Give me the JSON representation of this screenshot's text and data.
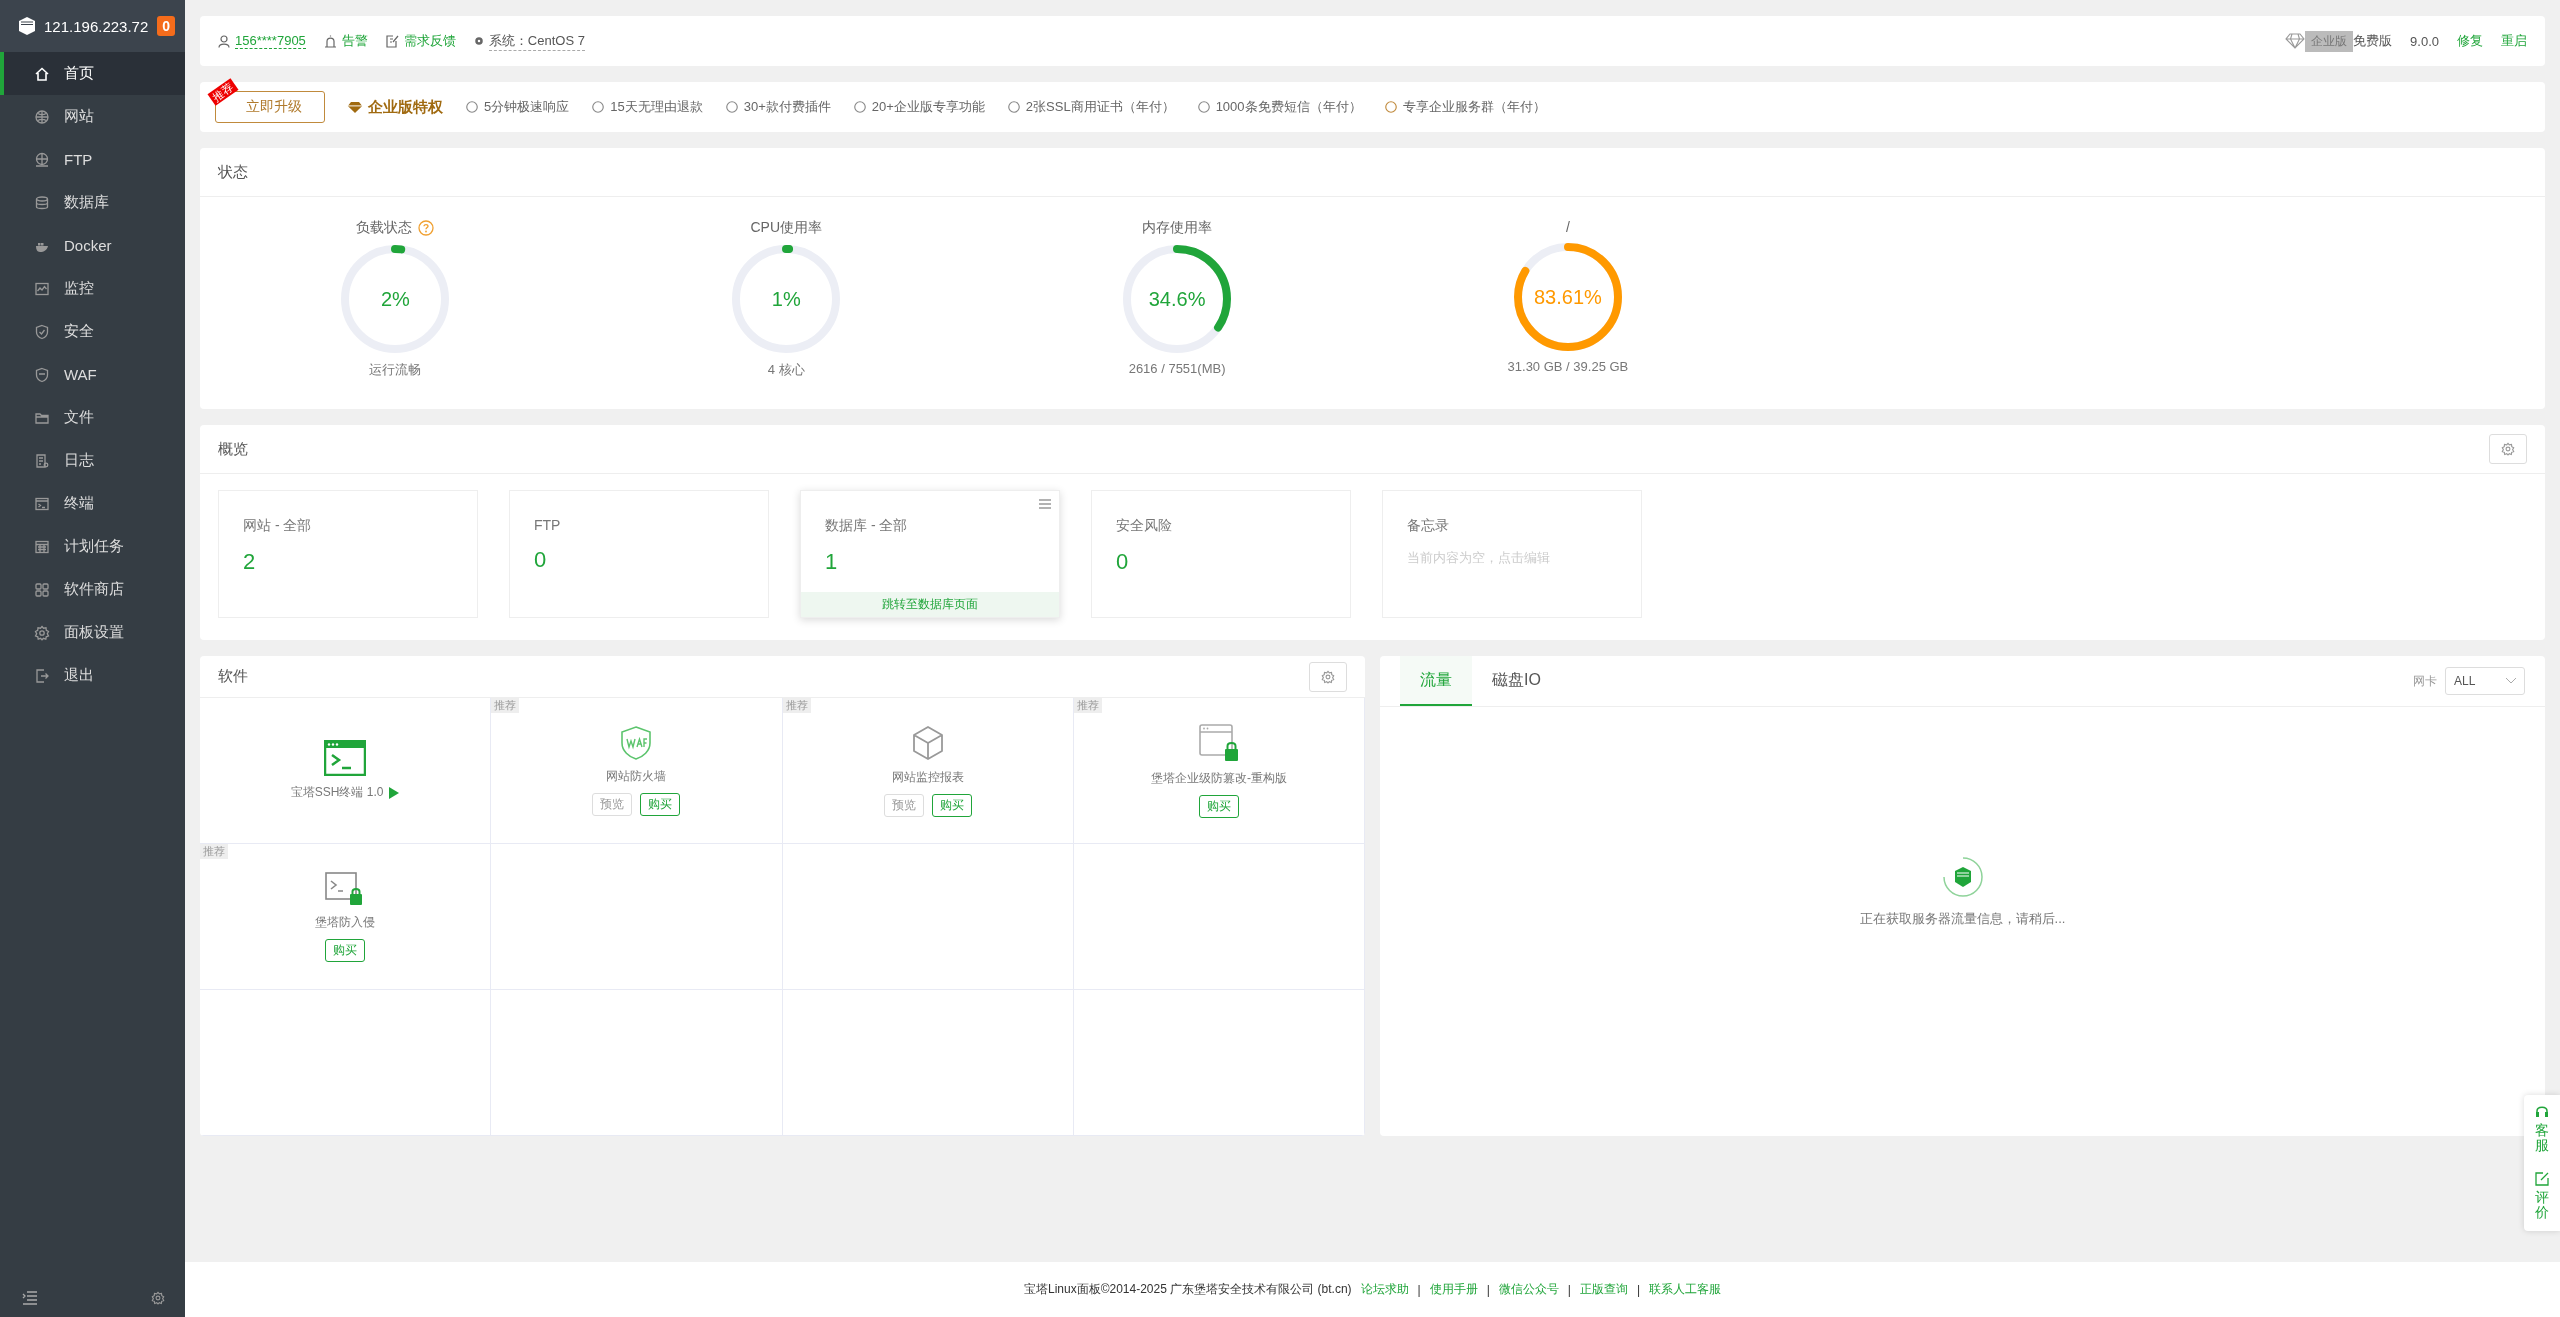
{
  "sidebar": {
    "host": "121.196.223.72",
    "badge": "0",
    "items": [
      {
        "label": "首页",
        "selected": true
      },
      {
        "label": "网站",
        "selected": false
      },
      {
        "label": "FTP",
        "selected": false
      },
      {
        "label": "数据库",
        "selected": false
      },
      {
        "label": "Docker",
        "selected": false
      },
      {
        "label": "监控",
        "selected": false
      },
      {
        "label": "安全",
        "selected": false
      },
      {
        "label": "WAF",
        "selected": false
      },
      {
        "label": "文件",
        "selected": false
      },
      {
        "label": "日志",
        "selected": false
      },
      {
        "label": "终端",
        "selected": false
      },
      {
        "label": "计划任务",
        "selected": false
      },
      {
        "label": "软件商店",
        "selected": false
      },
      {
        "label": "面板设置",
        "selected": false
      },
      {
        "label": "退出",
        "selected": false
      }
    ]
  },
  "topbar": {
    "user": "156****7905",
    "alert": "告警",
    "feedback": "需求反馈",
    "system": "系统：CentOS 7",
    "edition_badge": "企业版",
    "edition": "免费版",
    "version": "9.0.0",
    "repair": "修复",
    "restart": "重启"
  },
  "banner": {
    "upgrade": "立即升级",
    "ribbon": "推荐",
    "title": "企业版特权",
    "features": [
      "5分钟极速响应",
      "15天无理由退款",
      "30+款付费插件",
      "20+企业版专享功能",
      "2张SSL商用证书（年付）",
      "1000条免费短信（年付）",
      "专享企业服务群（年付）"
    ]
  },
  "status": {
    "title": "状态",
    "gauges": [
      {
        "title": "负载状态",
        "help": true,
        "value": "2%",
        "level": 0.02,
        "color": "#20a53a",
        "caption": "运行流畅"
      },
      {
        "title": "CPU使用率",
        "help": false,
        "value": "1%",
        "level": 0.01,
        "color": "#20a53a",
        "caption": "4 核心"
      },
      {
        "title": "内存使用率",
        "help": false,
        "value": "34.6%",
        "level": 0.346,
        "color": "#20a53a",
        "caption": "2616 / 7551(MB)"
      },
      {
        "title": "/",
        "help": false,
        "value": "83.61%",
        "level": 0.8361,
        "color": "#ff9900",
        "caption": "31.30 GB / 39.25 GB"
      }
    ]
  },
  "overview": {
    "title": "概览",
    "cards": [
      {
        "kind": "count",
        "title": "网站 - 全部",
        "value": "2",
        "hovered": false
      },
      {
        "kind": "count",
        "title": "FTP",
        "value": "0",
        "hovered": false
      },
      {
        "kind": "count",
        "title": "数据库 - 全部",
        "value": "1",
        "hovered": true,
        "link": "跳转至数据库页面"
      },
      {
        "kind": "count",
        "title": "安全风险",
        "value": "0",
        "hovered": false
      },
      {
        "kind": "memo",
        "title": "备忘录",
        "value": "当前内容为空，点击编辑",
        "hovered": false
      }
    ]
  },
  "software": {
    "title": "软件",
    "items": [
      {
        "kind": "terminal",
        "name": "宝塔SSH终端 1.0",
        "playable": true
      },
      {
        "kind": "firewall",
        "name": "网站防火墙",
        "tag": "推荐",
        "buttons": [
          "预览",
          "购买"
        ]
      },
      {
        "kind": "monitor",
        "name": "网站监控报表",
        "tag": "推荐",
        "buttons": [
          "预览",
          "购买"
        ]
      },
      {
        "kind": "tamper",
        "name": "堡塔企业级防篡改-重构版",
        "tag": "推荐",
        "buttons": [
          "购买"
        ]
      },
      {
        "kind": "intrusion",
        "name": "堡塔防入侵",
        "tag": "推荐",
        "buttons": [
          "购买"
        ]
      }
    ]
  },
  "traffic": {
    "tabs": [
      {
        "label": "流量",
        "selected": true
      },
      {
        "label": "磁盘IO",
        "selected": false
      }
    ],
    "nic_label": "网卡",
    "nic": "ALL",
    "message": "正在获取服务器流量信息，请稍后..."
  },
  "footer": {
    "copyright": "宝塔Linux面板©2014-2025 广东堡塔安全技术有限公司 (bt.cn)",
    "items": [
      {
        "kind": "link",
        "text": "论坛求助"
      },
      {
        "kind": "separator",
        "text": "|"
      },
      {
        "kind": "link",
        "text": "使用手册"
      },
      {
        "kind": "separator",
        "text": "|"
      },
      {
        "kind": "link",
        "text": "微信公众号"
      },
      {
        "kind": "separator",
        "text": "|"
      },
      {
        "kind": "link",
        "text": "正版查询"
      },
      {
        "kind": "separator",
        "text": "|"
      },
      {
        "kind": "link",
        "text": "联系人工客服"
      }
    ]
  },
  "float": {
    "service": "客服",
    "review": "评价"
  }
}
